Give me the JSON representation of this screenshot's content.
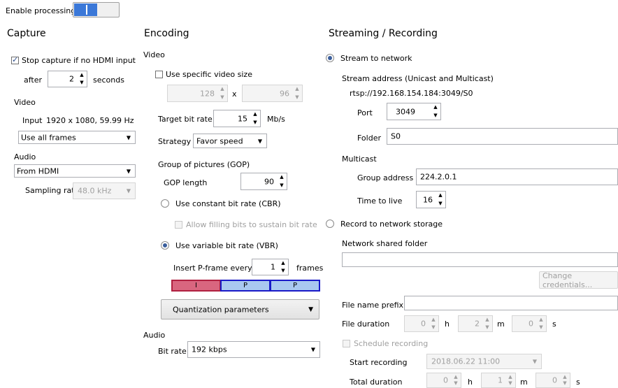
{
  "top": {
    "enable_label": "Enable processing",
    "toggle_state": "on"
  },
  "capture": {
    "title": "Capture",
    "stop_label": "Stop capture if no HDMI input",
    "after_label": "after",
    "after_value": "2",
    "seconds_label": "seconds",
    "video_title": "Video",
    "input_label": "Input",
    "input_value": "1920 x 1080, 59.99 Hz",
    "frames_select": "Use all frames",
    "audio_title": "Audio",
    "audio_select": "From HDMI",
    "sampling_label": "Sampling rate",
    "sampling_value": "48.0 kHz"
  },
  "encoding": {
    "title": "Encoding",
    "video_title": "Video",
    "use_size_label": "Use specific video size",
    "width_value": "128",
    "x_label": "x",
    "height_value": "96",
    "target_label": "Target bit rate",
    "target_value": "15",
    "target_unit": "Mb/s",
    "strategy_label": "Strategy",
    "strategy_value": "Favor speed",
    "gop_title": "Group of pictures (GOP)",
    "gop_length_label": "GOP length",
    "gop_length_value": "90",
    "cbr_label": "Use constant bit rate (CBR)",
    "fill_bits_label": "Allow filling bits to sustain bit rate",
    "vbr_label": "Use variable bit rate (VBR)",
    "pframe_label": "Insert P-frame every",
    "pframe_value": "1",
    "frames_label": "frames",
    "gop_frames": [
      "I",
      "P",
      "P"
    ],
    "quant_label": "Quantization parameters",
    "audio_title": "Audio",
    "bitrate_label": "Bit rate",
    "bitrate_value": "192 kbps"
  },
  "streaming": {
    "title": "Streaming / Recording",
    "stream_label": "Stream to network",
    "address_title": "Stream address (Unicast and Multicast)",
    "address_value": "rtsp://192.168.154.184:3049/S0",
    "port_label": "Port",
    "port_value": "3049",
    "folder_label": "Folder",
    "folder_value": "S0",
    "multicast_title": "Multicast",
    "group_label": "Group address",
    "group_value": "224.2.0.1",
    "ttl_label": "Time to live",
    "ttl_value": "16",
    "record_label": "Record to network storage",
    "shared_label": "Network shared folder",
    "shared_value": "",
    "cred_label": "Change credentials...",
    "prefix_label": "File name prefix",
    "prefix_value": "",
    "duration_label": "File duration",
    "dur_h": "0",
    "h_label": "h",
    "dur_m": "2",
    "m_label": "m",
    "dur_s": "0",
    "s_label": "s",
    "schedule_label": "Schedule recording",
    "start_label": "Start recording",
    "start_value": "2018.06.22 11:00",
    "total_label": "Total duration",
    "tot_h": "0",
    "tot_m": "1",
    "tot_s": "0"
  },
  "colors": {
    "accent": "#3b78d8",
    "i_frame": "#d9667f",
    "p_frame": "#a9c8f0",
    "p_border": "#1a1ac8"
  }
}
